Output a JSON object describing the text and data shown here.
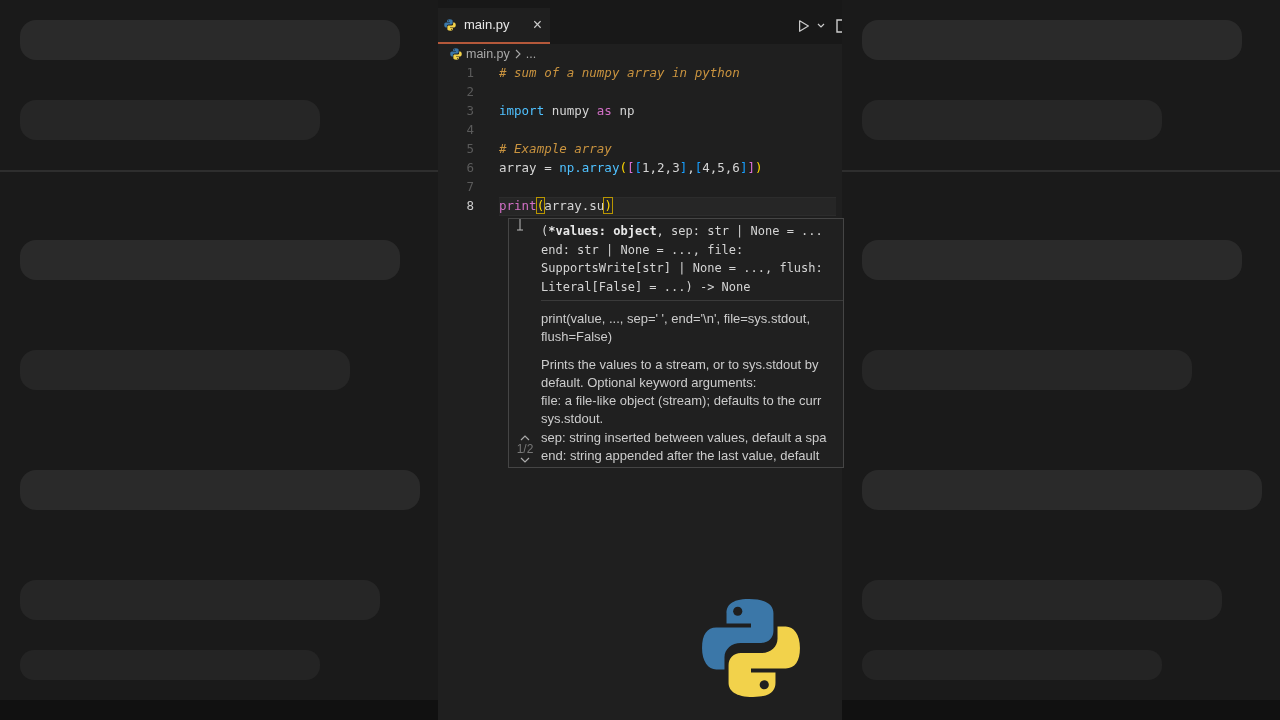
{
  "tabs": [
    {
      "label": "main.py",
      "selected": true,
      "close": "×"
    }
  ],
  "breadcrumb": [
    "main.py",
    "..."
  ],
  "code": [
    {
      "number": "1",
      "active": false,
      "tokens": [
        {
          "text": "# sum of a numpy array in python",
          "kind": "comment"
        }
      ]
    },
    {
      "number": "2",
      "active": false
    },
    {
      "number": "3",
      "active": false,
      "tokens": [
        {
          "text": "import",
          "kind": "keyword"
        },
        {
          "text": " numpy ",
          "kind": "plain"
        },
        {
          "text": "as",
          "kind": "control"
        },
        {
          "text": " np",
          "kind": "plain"
        }
      ]
    },
    {
      "number": "4",
      "active": false
    },
    {
      "number": "5",
      "active": false,
      "tokens": [
        {
          "text": "# Example array",
          "kind": "comment"
        }
      ]
    },
    {
      "number": "6",
      "active": false,
      "tokens": [
        {
          "text": "array = ",
          "kind": "plain"
        },
        {
          "text": "np.array",
          "kind": "function"
        },
        {
          "text": "(",
          "kind": "bracket1"
        },
        {
          "text": "[",
          "kind": "bracket2"
        },
        {
          "text": "[",
          "kind": "bracket3"
        },
        {
          "text": "1,2,3",
          "kind": "plain"
        },
        {
          "text": "]",
          "kind": "bracket3"
        },
        {
          "text": ",",
          "kind": "plain"
        },
        {
          "text": "[",
          "kind": "bracket3"
        },
        {
          "text": "4,5,6",
          "kind": "plain"
        },
        {
          "text": "]",
          "kind": "bracket3"
        },
        {
          "text": "]",
          "kind": "bracket2"
        },
        {
          "text": ")",
          "kind": "bracket1"
        }
      ]
    },
    {
      "number": "7",
      "active": false
    },
    {
      "number": "8",
      "active": true,
      "tokens": [
        {
          "text": "print",
          "kind": "control"
        },
        {
          "text": "(",
          "kind": "matched"
        },
        {
          "text": "array.su",
          "kind": "plain"
        },
        {
          "text": ")",
          "kind": "matched"
        }
      ]
    }
  ],
  "hover": {
    "signature": [
      [
        {
          "text": "(",
          "bold": false
        },
        {
          "text": "*values: object",
          "bold": true
        },
        {
          "text": ", sep: str | None = ...",
          "bold": false
        }
      ],
      [
        {
          "text": "end: str | None = ..., file:",
          "bold": false
        }
      ],
      [
        {
          "text": "SupportsWrite[str] | None = ..., flush:",
          "bold": false
        }
      ],
      [
        {
          "text": "Literal[False] = ...) -> None",
          "bold": false
        }
      ]
    ],
    "doc_blocks": [
      [
        "print(value, ..., sep=' ', end='\\n', file=sys.stdout,",
        "flush=False)"
      ],
      [
        "Prints the values to a stream, or to sys.stdout by",
        "default. Optional keyword arguments:",
        "file: a file-like object (stream); defaults to the curr",
        "sys.stdout.",
        "sep: string inserted between values, default a spa",
        "end: string appended after the last value, default"
      ]
    ],
    "pager": "1/2"
  }
}
